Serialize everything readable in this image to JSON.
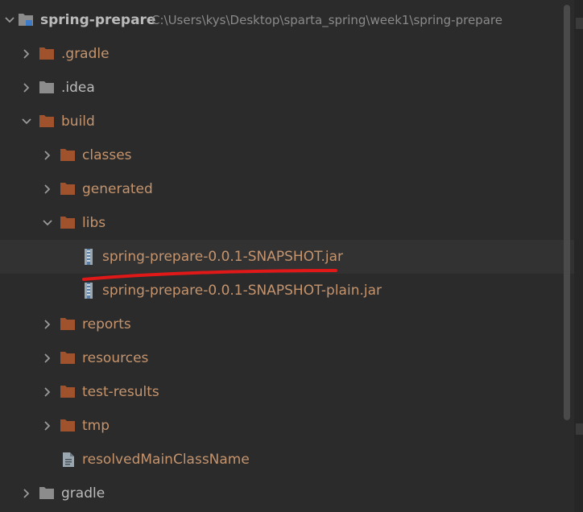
{
  "project": {
    "name": "spring-prepare",
    "path": "C:\\Users\\kys\\Desktop\\sparta_spring\\week1\\spring-prepare"
  },
  "tree": [
    {
      "label": ".gradle",
      "icon": "folder-icon",
      "expanded": false
    },
    {
      "label": ".idea",
      "icon": "folder-icon",
      "expanded": false
    },
    {
      "label": "build",
      "icon": "folder-icon",
      "expanded": true
    },
    {
      "label": "classes",
      "icon": "folder-icon",
      "expanded": false
    },
    {
      "label": "generated",
      "icon": "folder-icon",
      "expanded": false
    },
    {
      "label": "libs",
      "icon": "folder-icon",
      "expanded": true
    },
    {
      "label": "spring-prepare-0.0.1-SNAPSHOT.jar",
      "icon": "jar-archive-icon",
      "selected": true
    },
    {
      "label": "spring-prepare-0.0.1-SNAPSHOT-plain.jar",
      "icon": "jar-archive-icon"
    },
    {
      "label": "reports",
      "icon": "folder-icon",
      "expanded": false
    },
    {
      "label": "resources",
      "icon": "folder-icon",
      "expanded": false
    },
    {
      "label": "test-results",
      "icon": "folder-icon",
      "expanded": false
    },
    {
      "label": "tmp",
      "icon": "folder-icon",
      "expanded": false
    },
    {
      "label": "resolvedMainClassName",
      "icon": "file-icon"
    },
    {
      "label": "gradle",
      "icon": "folder-icon",
      "expanded": false
    }
  ],
  "colors": {
    "background": "#2b2b2b",
    "excluded_folder": "#a0522d",
    "excluded_text": "#c5946d",
    "plain_folder": "#8c8c8c",
    "default_text": "#bbbbbb",
    "annotation_underline": "#e01818"
  }
}
